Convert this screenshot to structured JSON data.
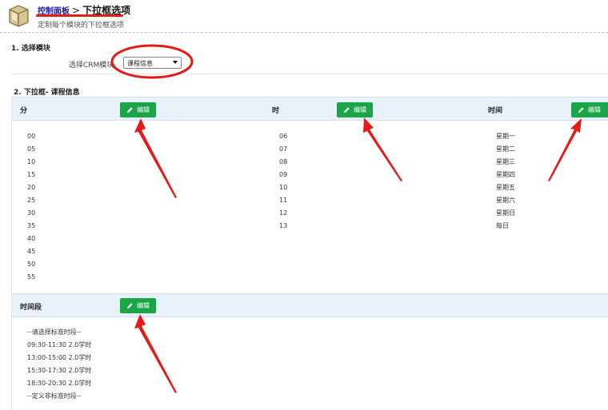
{
  "header": {
    "breadcrumb_link": "控制面板",
    "breadcrumb_sep": ">",
    "breadcrumb_current": "下拉框选项",
    "subtitle": "定制每个模块的下拉框选项"
  },
  "section1": {
    "title": "1. 选择模块",
    "select_label": "选择CRM模块",
    "select_value": "课程信息"
  },
  "section2": {
    "title": "2. 下拉框- 课程信息",
    "edit_label": "编辑",
    "columns": [
      {
        "header": "分",
        "items": [
          "00",
          "05",
          "10",
          "15",
          "20",
          "25",
          "30",
          "35",
          "40",
          "45",
          "50",
          "55"
        ]
      },
      {
        "header": "时",
        "items": [
          "06",
          "07",
          "08",
          "09",
          "10",
          "11",
          "12",
          "13"
        ]
      },
      {
        "header": "时间",
        "items": [
          "星期一",
          "星期二",
          "星期三",
          "星期四",
          "星期五",
          "星期六",
          "星期日",
          "每日"
        ]
      }
    ],
    "period": {
      "header": "时间段",
      "items": [
        "--请选择标准时段--",
        "09:30-11:30 2.0学时",
        "13:00-15:00 2.0学时",
        "15:30-17:30 2.0学时",
        "18:30-20:30 2.0学时",
        "--定义非标准时段--"
      ]
    }
  },
  "colors": {
    "accent_green": "#1aa648",
    "annotation_red": "#e31b1b",
    "header_band": "#e9f1fb",
    "link_blue": "#1a1aa0"
  }
}
